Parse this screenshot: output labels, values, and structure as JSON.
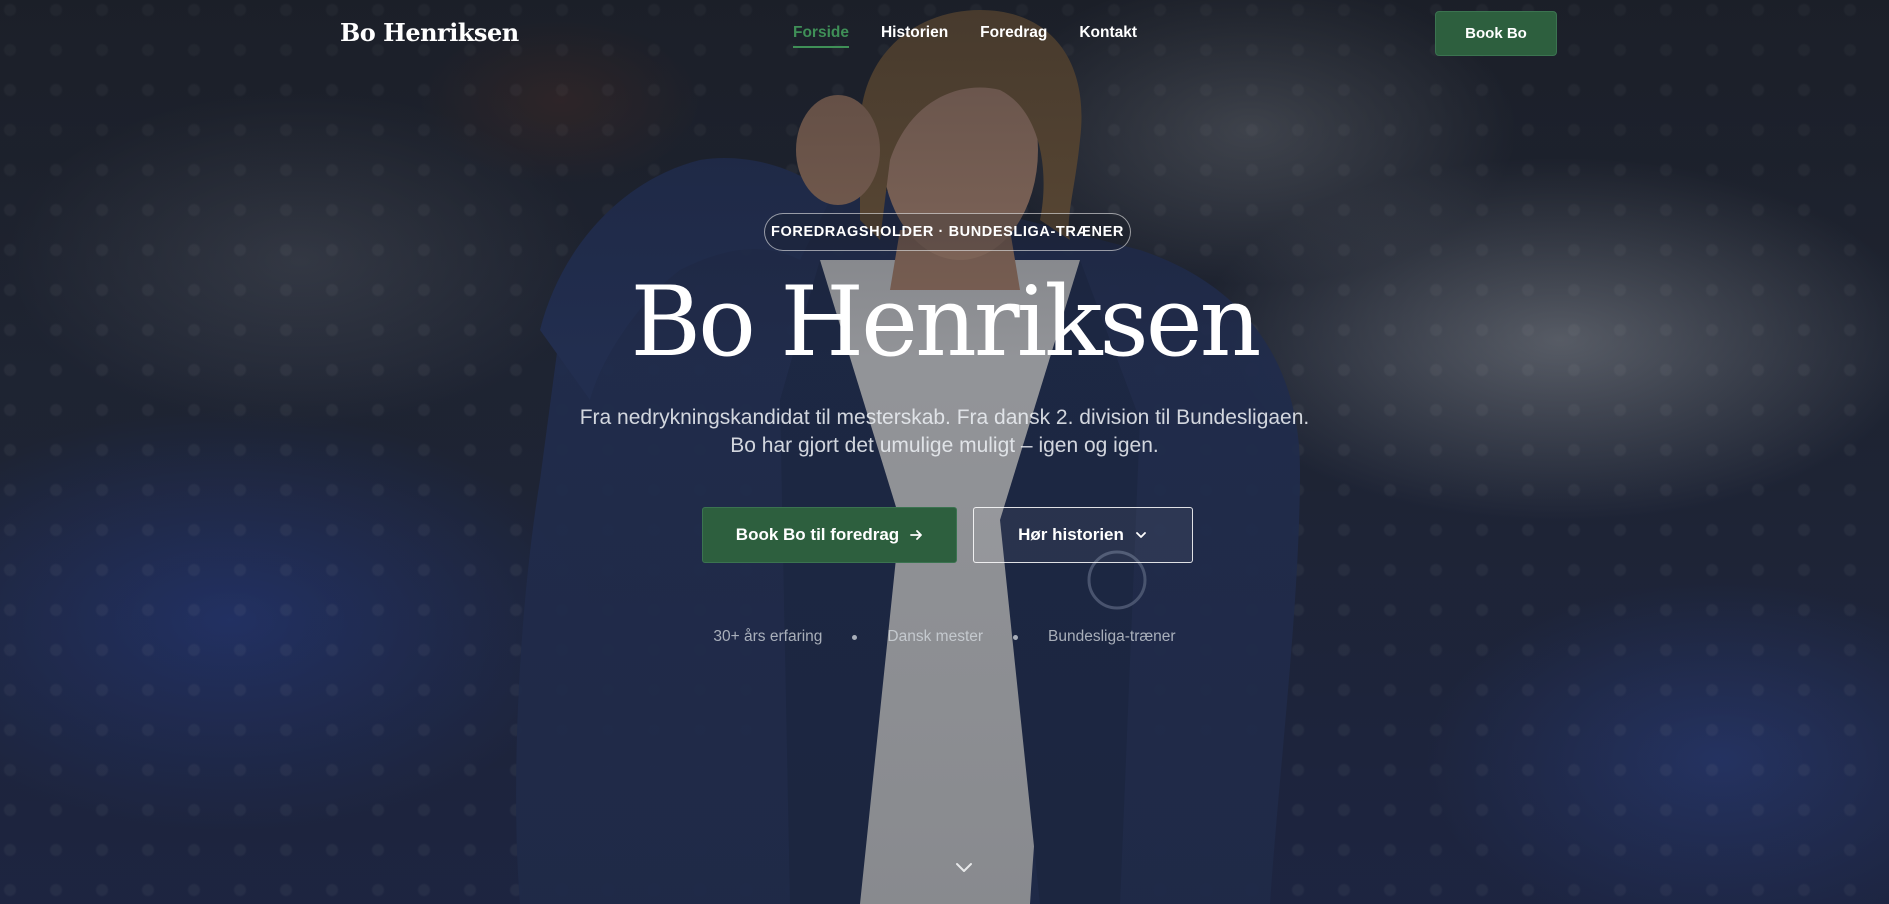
{
  "nav": {
    "brand": "Bo Henriksen",
    "links": [
      {
        "label": "Forside",
        "active": true
      },
      {
        "label": "Historien",
        "active": false
      },
      {
        "label": "Foredrag",
        "active": false
      },
      {
        "label": "Kontakt",
        "active": false
      }
    ],
    "cta_label": "Book Bo"
  },
  "hero": {
    "eyebrow": "FOREDRAGSHOLDER · BUNDESLIGA-TRÆNER",
    "title": "Bo Henriksen",
    "subtitle_line1": "Fra nedrykningskandidat til mesterskab. Fra dansk 2. division til Bundesligaen.",
    "subtitle_line2": "Bo har gjort det umulige muligt – igen og igen.",
    "primary_button": {
      "label": "Book Bo til foredrag",
      "icon": "arrow-right-icon"
    },
    "secondary_button": {
      "label": "Hør historien",
      "icon": "chevron-down-icon"
    },
    "stats": [
      "30+ års erfaring",
      "Dansk mester",
      "Bundesliga-træner"
    ],
    "scroll_icon": "chevron-down-icon"
  },
  "colors": {
    "accent": "#2d5f3e",
    "nav_active": "#3f8f57"
  }
}
